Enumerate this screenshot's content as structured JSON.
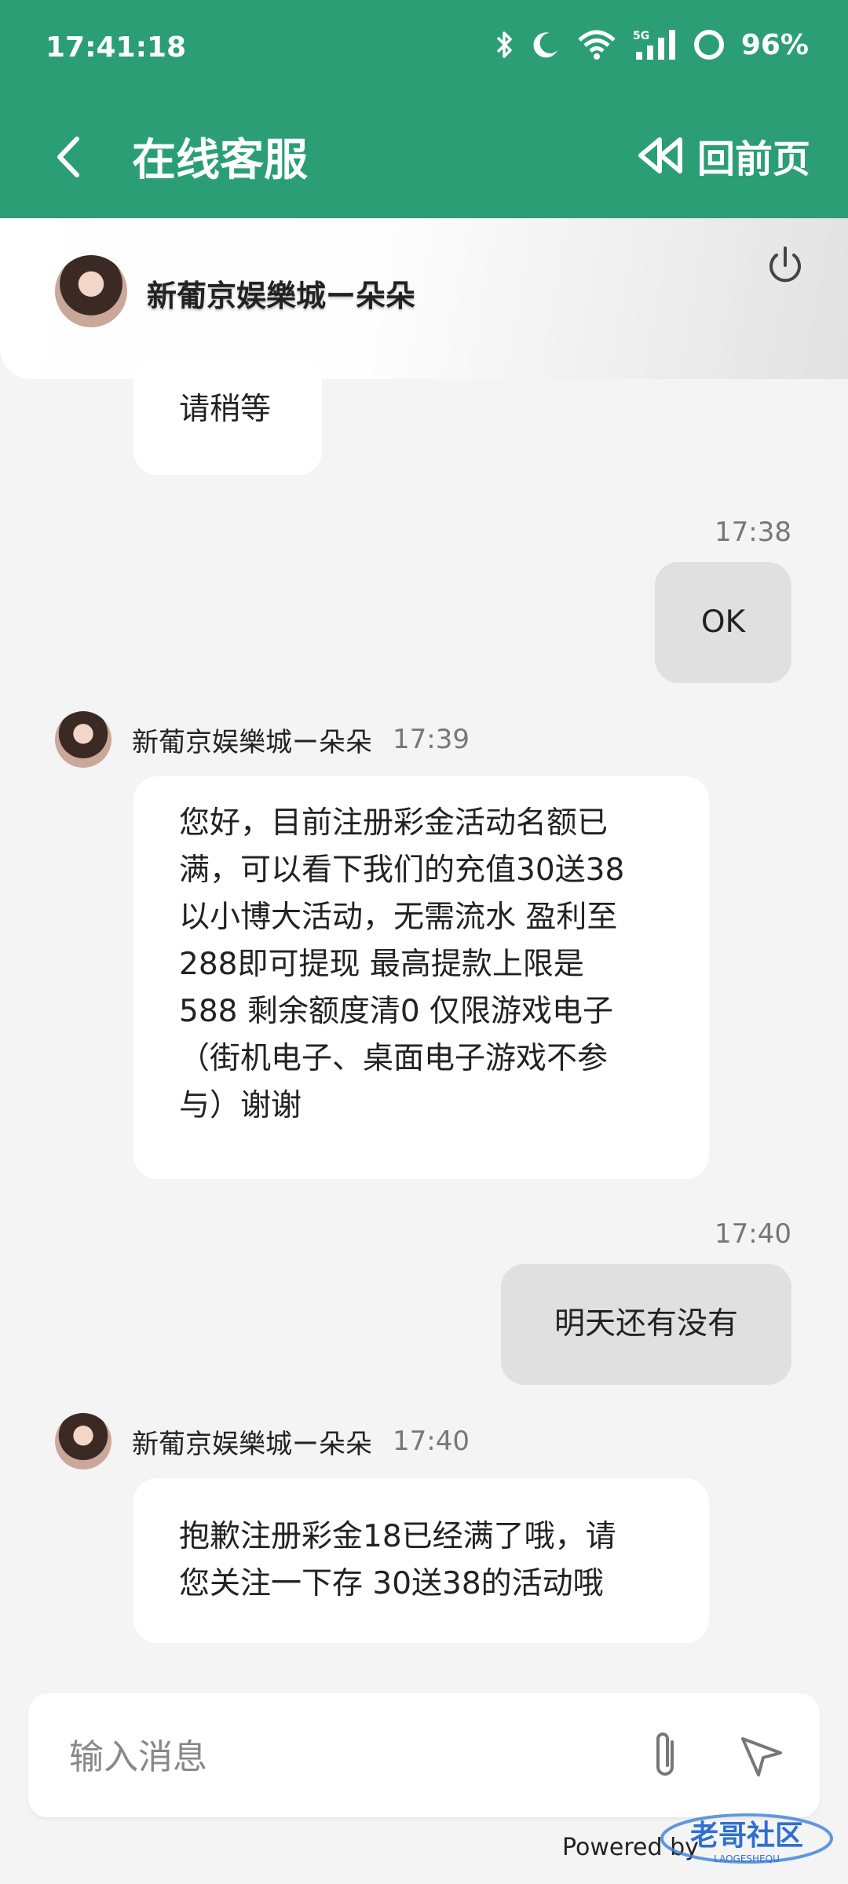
{
  "status_bar": {
    "time": "17:41:18",
    "network": "5G",
    "battery": "96%"
  },
  "nav": {
    "title": "在线客服",
    "home_label": "回前页"
  },
  "agent": {
    "name": "新葡京娱樂城ー朵朵"
  },
  "messages": [
    {
      "side": "left",
      "text": "请稍等"
    },
    {
      "side": "right",
      "time": "17:38",
      "text": "OK"
    },
    {
      "side": "left",
      "sender": "新葡京娱樂城ー朵朵",
      "time": "17:39",
      "lines": [
        "您好，目前注册彩金活动名额已",
        "满，可以看下我们的充值30送38",
        "以小博大活动，无需流水 盈利至",
        "288即可提现 最高提款上限是",
        "588 剩余额度清0 仅限游戏电子",
        "（街机电子、桌面电子游戏不参",
        "与）谢谢"
      ]
    },
    {
      "side": "right",
      "time": "17:40",
      "text": "明天还有没有"
    },
    {
      "side": "left",
      "sender": "新葡京娱樂城ー朵朵",
      "time": "17:40",
      "lines": [
        "抱歉注册彩金18已经满了哦，请",
        "您关注一下存 30送38的活动哦"
      ]
    }
  ],
  "input": {
    "placeholder": "输入消息"
  },
  "footer": {
    "powered": "Powered by"
  },
  "watermark": {
    "text": "老哥社区",
    "subtext": "LAOGESHEQU"
  },
  "colors": {
    "brand": "#2b9e76",
    "bubble_left": "#ffffff",
    "bubble_right": "#e0e0e0",
    "background": "#f4f4f4"
  }
}
